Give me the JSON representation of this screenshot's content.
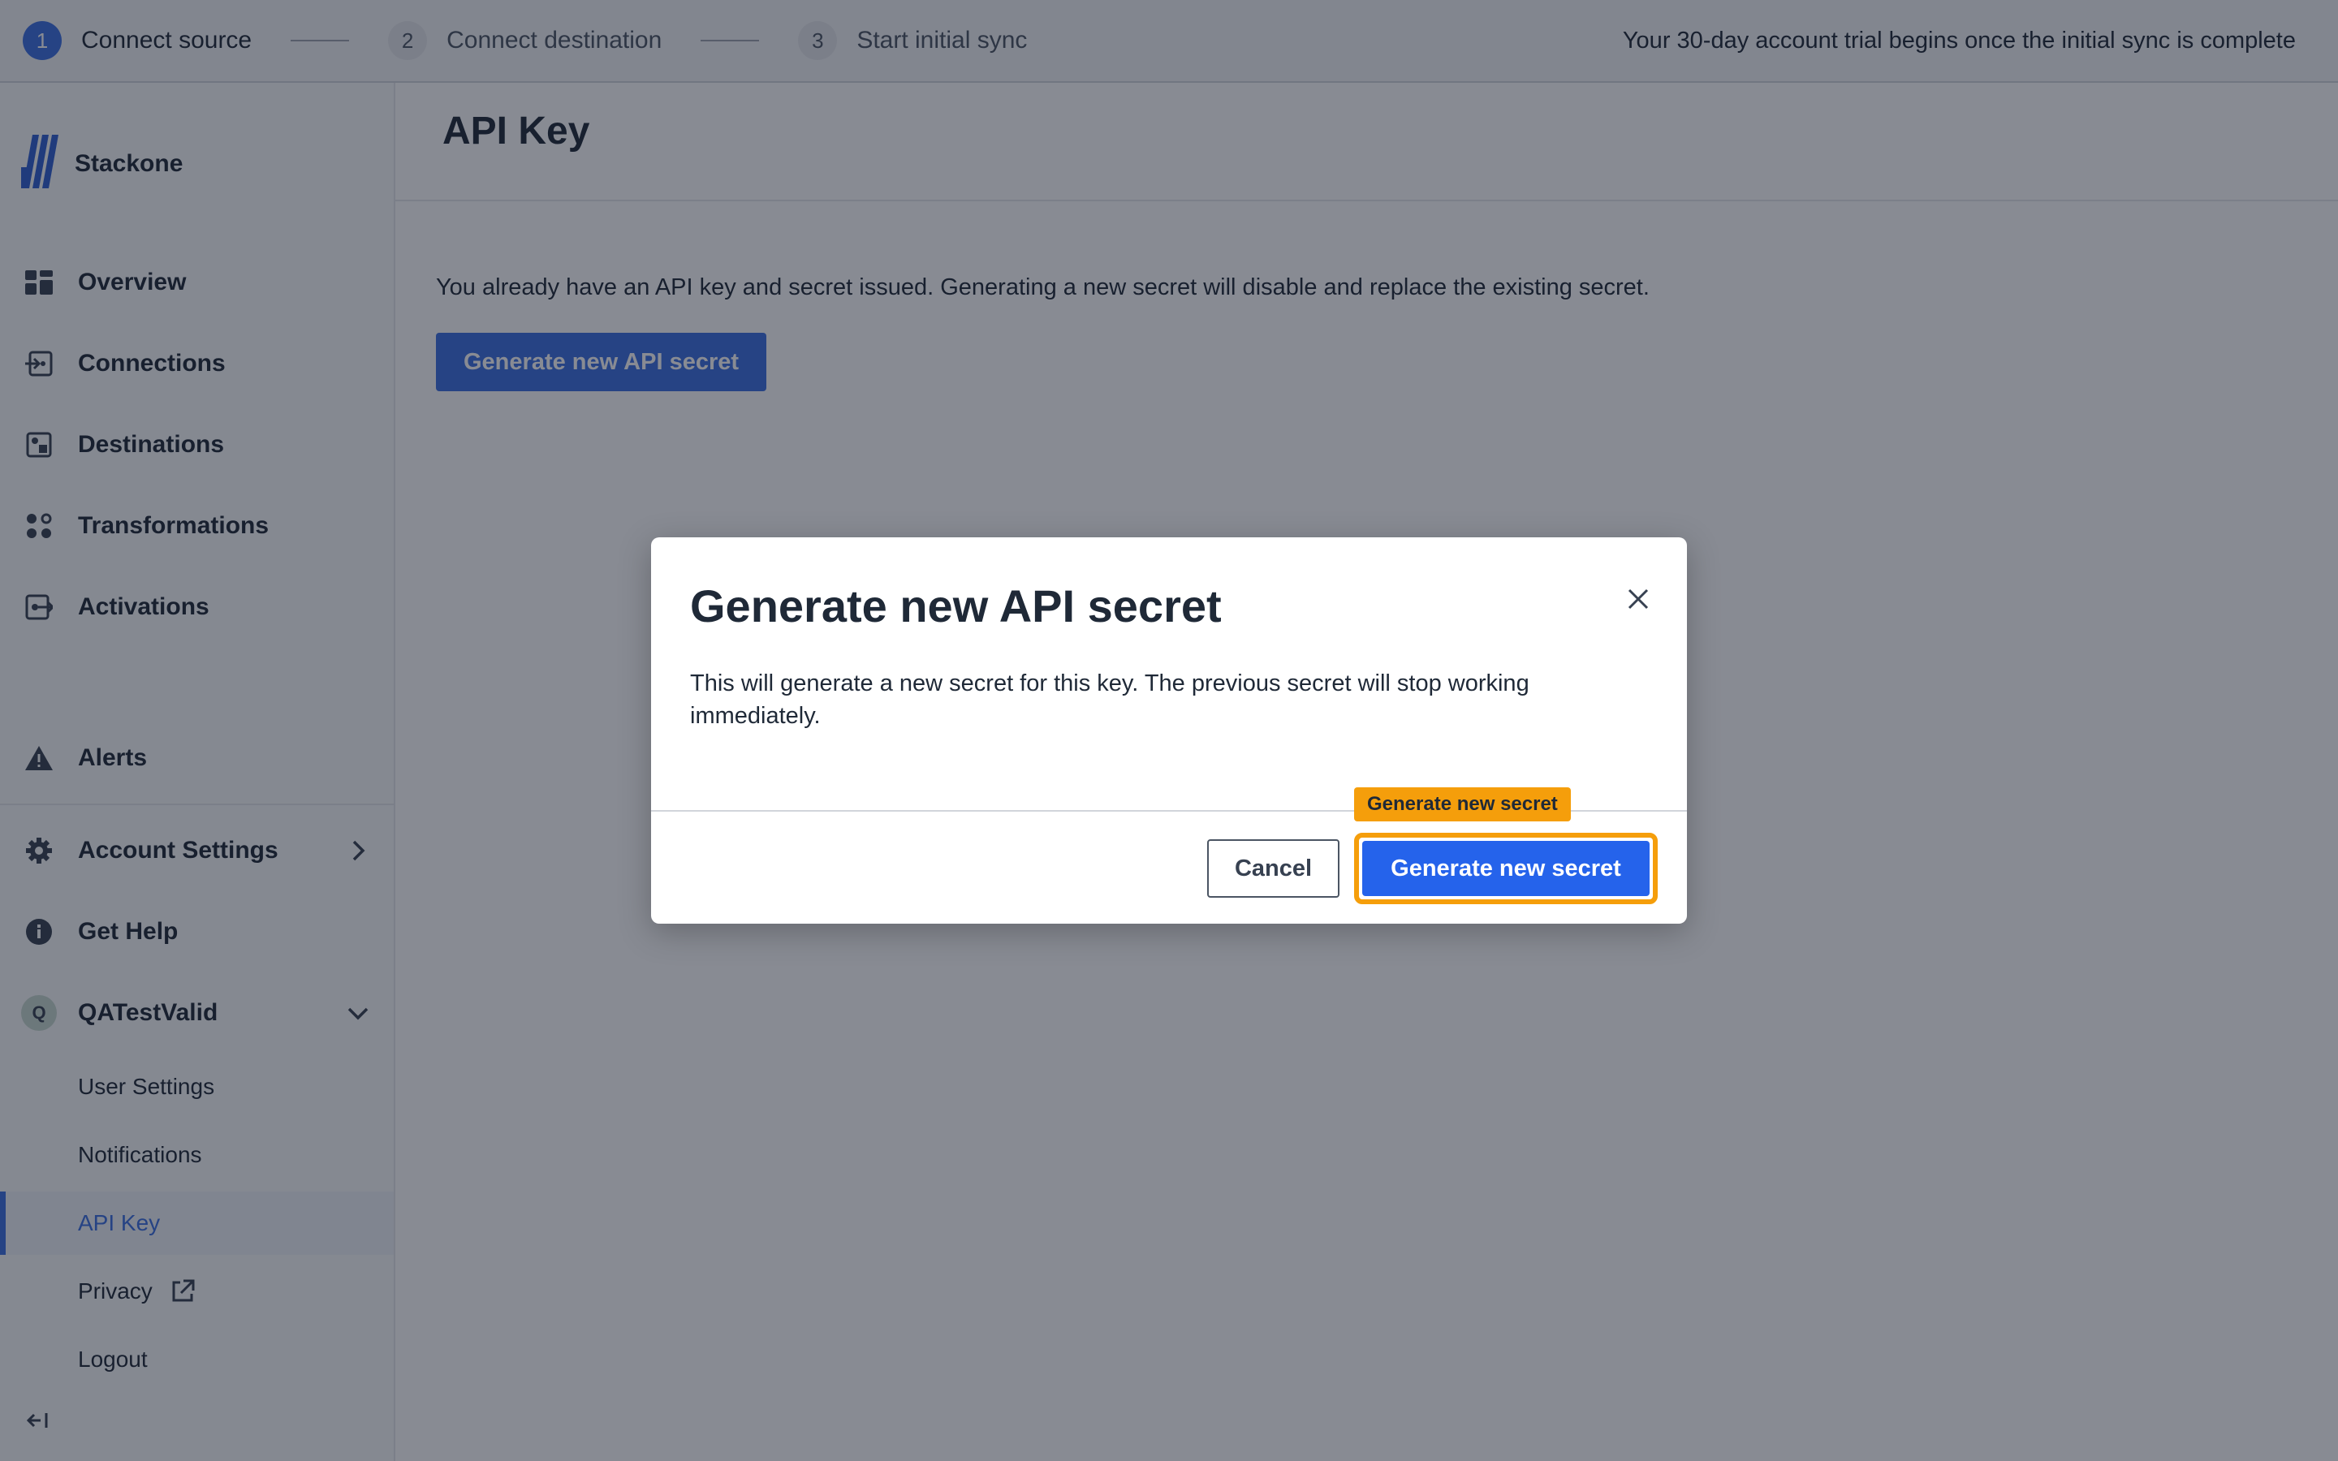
{
  "stepper": {
    "steps": [
      {
        "number": "1",
        "label": "Connect source",
        "active": true
      },
      {
        "number": "2",
        "label": "Connect destination",
        "active": false
      },
      {
        "number": "3",
        "label": "Start initial sync",
        "active": false
      }
    ],
    "trial_notice": "Your 30-day account trial begins once the initial sync is complete"
  },
  "sidebar": {
    "brand": "Stackone",
    "nav": [
      {
        "label": "Overview",
        "icon": "dashboard-icon"
      },
      {
        "label": "Connections",
        "icon": "connection-icon"
      },
      {
        "label": "Destinations",
        "icon": "destination-icon"
      },
      {
        "label": "Transformations",
        "icon": "transformation-icon"
      },
      {
        "label": "Activations",
        "icon": "activation-icon"
      }
    ],
    "alerts": "Alerts",
    "account_settings": "Account Settings",
    "get_help": "Get Help",
    "user": {
      "initial": "Q",
      "name": "QATestValid"
    },
    "user_menu": [
      {
        "label": "User Settings",
        "active": false
      },
      {
        "label": "Notifications",
        "active": false
      },
      {
        "label": "API Key",
        "active": true
      },
      {
        "label": "Privacy",
        "active": false,
        "external": true
      },
      {
        "label": "Logout",
        "active": false
      }
    ]
  },
  "main": {
    "title": "API Key",
    "info": "You already have an API key and secret issued. Generating a new secret will disable and replace the existing secret.",
    "generate_button": "Generate new API secret"
  },
  "modal": {
    "title": "Generate new API secret",
    "body": "This will generate a new secret for this key. The previous secret will stop working immediately.",
    "cancel": "Cancel",
    "confirm": "Generate new secret",
    "tooltip": "Generate new secret"
  },
  "colors": {
    "accent": "#3b6fe0",
    "highlight": "#f59e0b",
    "overlay": "rgba(17,24,39,0.5)"
  }
}
